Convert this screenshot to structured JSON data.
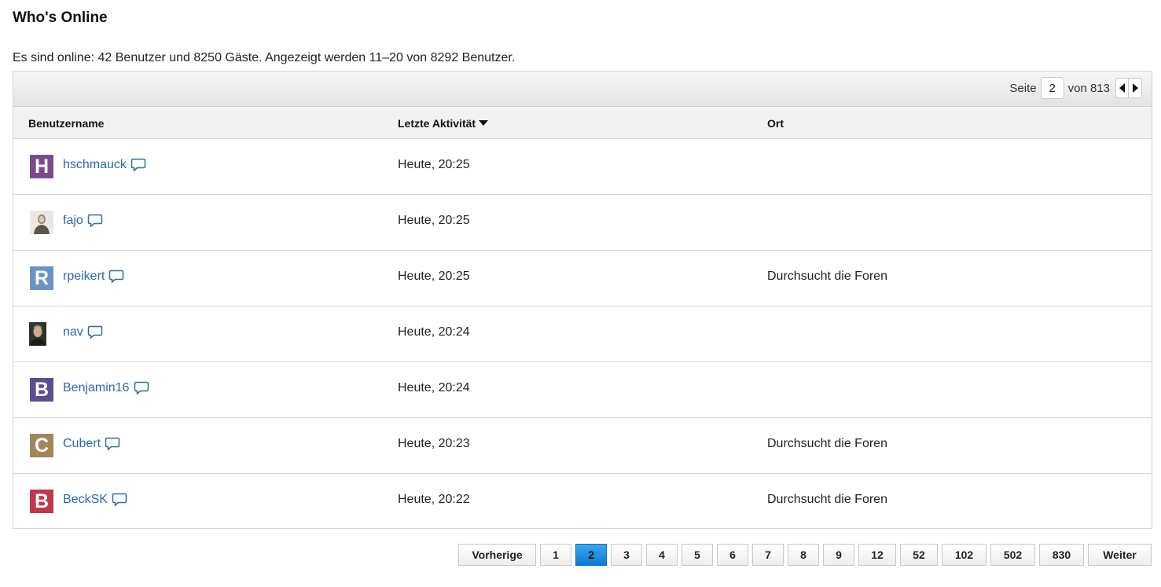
{
  "page_title": "Who's Online",
  "summary": "Es sind online: 42 Benutzer und 8250 Gäste. Angezeigt werden 11–20 von 8292 Benutzer.",
  "top_pager": {
    "page_label": "Seite",
    "current_page": "2",
    "of_label": "von 813"
  },
  "columns": {
    "username": "Benutzername",
    "last_activity": "Letzte Aktivität",
    "location": "Ort"
  },
  "rows": [
    {
      "initial": "H",
      "avatar_color": "#7a4b8c",
      "username": "hschmauck",
      "activity": "Heute, 20:25",
      "location": ""
    },
    {
      "initial": "",
      "avatar_color": "",
      "username": "fajo",
      "activity": "Heute, 20:25",
      "location": ""
    },
    {
      "initial": "R",
      "avatar_color": "#6b93c7",
      "username": "rpeikert",
      "activity": "Heute, 20:25",
      "location": "Durchsucht die Foren"
    },
    {
      "initial": "",
      "avatar_color": "",
      "username": "nav",
      "activity": "Heute, 20:24",
      "location": ""
    },
    {
      "initial": "B",
      "avatar_color": "#5d4e8f",
      "username": "Benjamin16",
      "activity": "Heute, 20:24",
      "location": ""
    },
    {
      "initial": "C",
      "avatar_color": "#a3855a",
      "username": "Cubert",
      "activity": "Heute, 20:23",
      "location": "Durchsucht die Foren"
    },
    {
      "initial": "B",
      "avatar_color": "#c0394a",
      "username": "BeckSK",
      "activity": "Heute, 20:22",
      "location": "Durchsucht die Foren"
    }
  ],
  "pagination": {
    "prev": "Vorherige",
    "pages": [
      "1",
      "2",
      "3",
      "4",
      "5",
      "6",
      "7",
      "8",
      "9",
      "12",
      "52",
      "102",
      "502",
      "830"
    ],
    "active": "2",
    "next": "Weiter"
  },
  "colors": {
    "link": "#2b6aa6",
    "active_page": "#1a8ae6"
  }
}
